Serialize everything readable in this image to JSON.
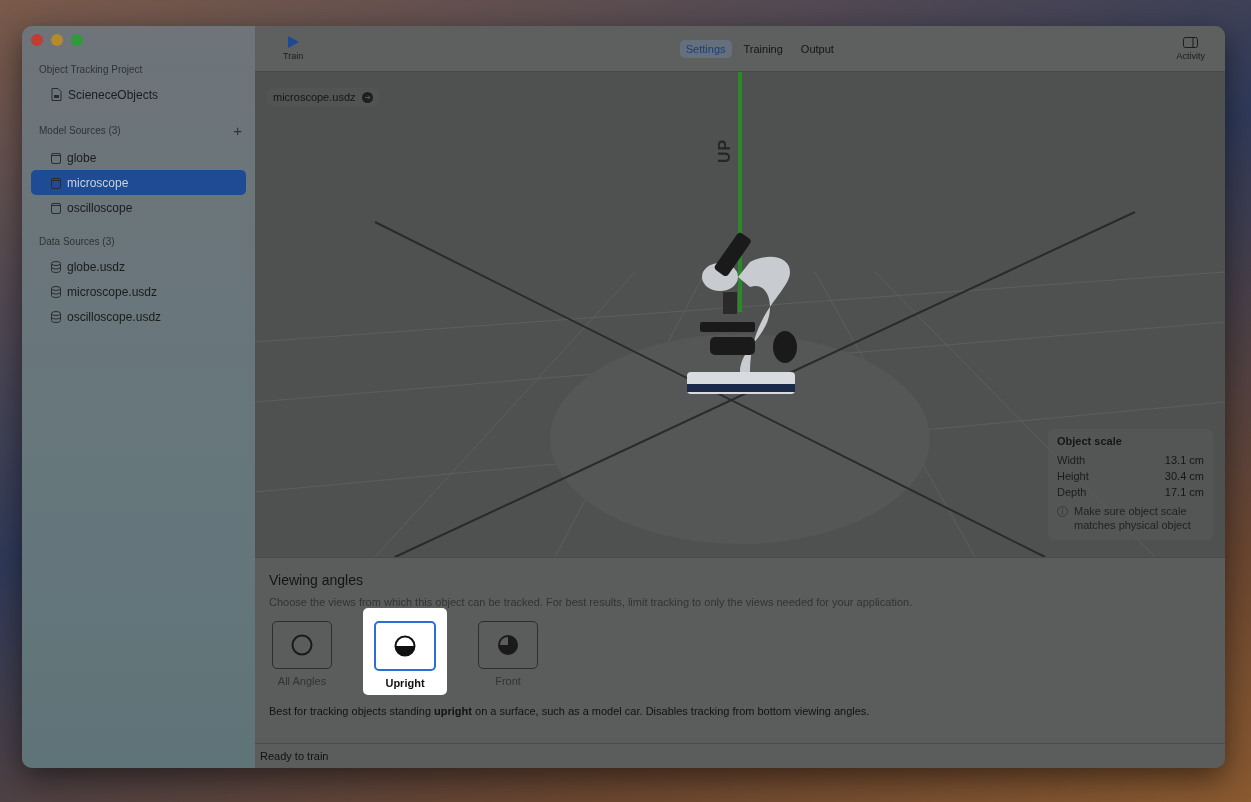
{
  "sidebar": {
    "sections": [
      {
        "header": "Object Tracking Project",
        "kind": "project",
        "items": [
          {
            "label": "ScieneceObjects",
            "selected": false
          }
        ]
      },
      {
        "header": "Model Sources (3)",
        "kind": "model",
        "add": "+",
        "items": [
          {
            "label": "globe",
            "selected": false
          },
          {
            "label": "microscope",
            "selected": true
          },
          {
            "label": "oscilloscope",
            "selected": false
          }
        ]
      },
      {
        "header": "Data Sources (3)",
        "kind": "data",
        "items": [
          {
            "label": "globe.usdz",
            "selected": false
          },
          {
            "label": "microscope.usdz",
            "selected": false
          },
          {
            "label": "oscilloscope.usdz",
            "selected": false
          }
        ]
      }
    ]
  },
  "toolbar": {
    "train": "Train",
    "tabs": [
      {
        "label": "Settings",
        "selected": true
      },
      {
        "label": "Training",
        "selected": false
      },
      {
        "label": "Output",
        "selected": false
      }
    ],
    "activity": "Activity"
  },
  "viewport": {
    "file_chip": "microscope.usdz",
    "axis_label": "UP",
    "object_scale": {
      "title": "Object scale",
      "rows": [
        {
          "label": "Width",
          "value": "13.1 cm"
        },
        {
          "label": "Height",
          "value": "30.4 cm"
        },
        {
          "label": "Depth",
          "value": "17.1 cm"
        }
      ],
      "note": "Make sure object scale matches physical object"
    }
  },
  "viewing_angles": {
    "title": "Viewing angles",
    "description": "Choose the views from which this object can be tracked. For best results, limit tracking to only the views needed for your application.",
    "options": [
      {
        "label": "All Angles",
        "kind": "all",
        "selected": false
      },
      {
        "label": "Upright",
        "kind": "upright",
        "selected": true
      },
      {
        "label": "Front",
        "kind": "front",
        "selected": false
      }
    ],
    "explanation": "Best for tracking objects standing **upright** on a surface, such as a model car. Disables tracking from bottom viewing angles."
  },
  "status_bar": "Ready to train"
}
